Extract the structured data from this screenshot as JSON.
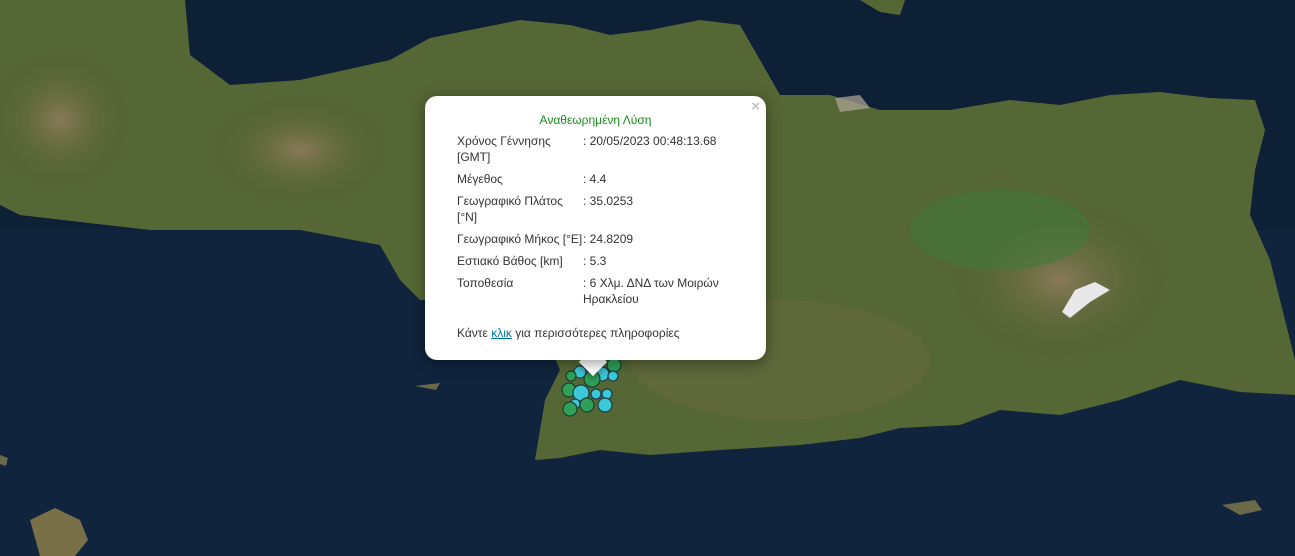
{
  "popup": {
    "title": "Αναθεωρημένη Λύση",
    "close": "×",
    "rows": [
      {
        "label": "Χρόνος Γέννησης [GMT]",
        "value": ": 20/05/2023 00:48:13.68"
      },
      {
        "label": "Μέγεθος",
        "value": ": 4.4"
      },
      {
        "label": "Γεωγραφικό Πλάτος [°N]",
        "value": ": 35.0253"
      },
      {
        "label": "Γεωγραφικό Μήκος [°E]",
        "value": ": 24.8209"
      },
      {
        "label": "Εστιακό Βάθος [km]",
        "value": ": 5.3"
      },
      {
        "label": "Τοποθεσία",
        "value": ": 6 Χλμ. ΔΝΔ των Μοιρών Ηρακλείου"
      }
    ],
    "more_prefix": "Κάντε ",
    "more_link": "κλικ",
    "more_suffix": " για περισσότερες πληροφορίες"
  },
  "colors": {
    "sea": "#0d1f33",
    "land": "#5a6b38",
    "marker_green": "#2ea05a",
    "marker_cyan": "#3cc8d8",
    "title_green": "#1a8a1a",
    "link": "#0078a8"
  }
}
